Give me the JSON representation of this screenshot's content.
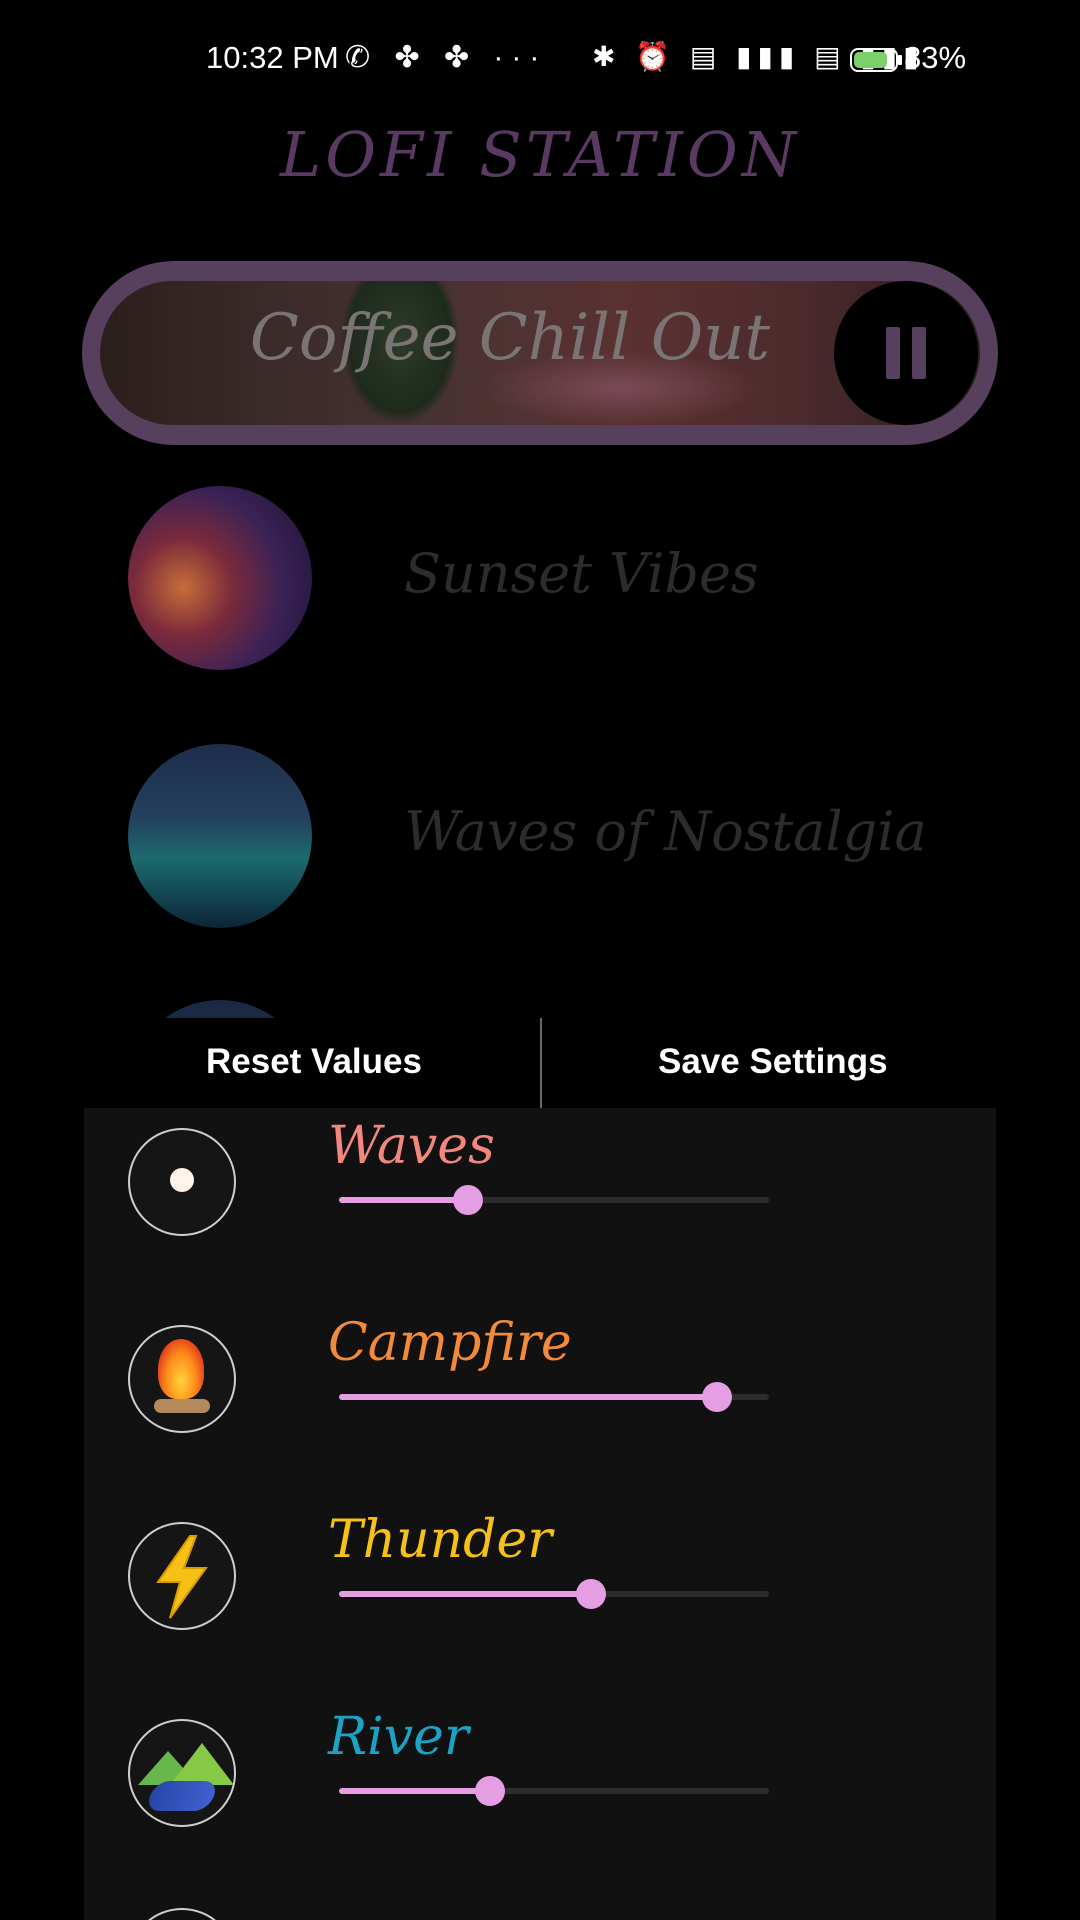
{
  "status_bar": {
    "time": "10:32 PM",
    "left_icons_text": "✆ ✤ ✤  ···",
    "right_icons_text": "✱ ⏰ ▤ ▮▮▮ ▤ ▮▮▮",
    "battery_percent": "83%",
    "battery_level": 0.83,
    "icons": [
      "whatsapp-icon",
      "app-icon",
      "app-icon",
      "more-icon",
      "bluetooth-icon",
      "alarm-icon",
      "volte-icon",
      "signal-icon",
      "volte-icon",
      "signal-icon",
      "battery-icon"
    ]
  },
  "app": {
    "title": "LOFI STATION"
  },
  "now_playing": {
    "title": "Coffee Chill Out",
    "state": "playing",
    "control_icon": "pause-icon"
  },
  "playlist": [
    {
      "title": "Sunset Vibes"
    },
    {
      "title": "Waves of Nostalgia"
    }
  ],
  "actions": {
    "reset_label": "Reset Values",
    "save_label": "Save Settings"
  },
  "sounds": [
    {
      "name": "Waves",
      "color": "#f2877e",
      "value": 0.3,
      "icon": "waves-icon"
    },
    {
      "name": "Campfire",
      "color": "#f28a3a",
      "value": 0.88,
      "icon": "campfire-icon"
    },
    {
      "name": "Thunder",
      "color": "#f6c117",
      "value": 0.585,
      "icon": "thunder-icon"
    },
    {
      "name": "River",
      "color": "#1ba3c6",
      "value": 0.35,
      "icon": "river-icon"
    }
  ],
  "colors": {
    "accent": "#e59de3",
    "panel": "#111111",
    "frame": "#56405e"
  }
}
